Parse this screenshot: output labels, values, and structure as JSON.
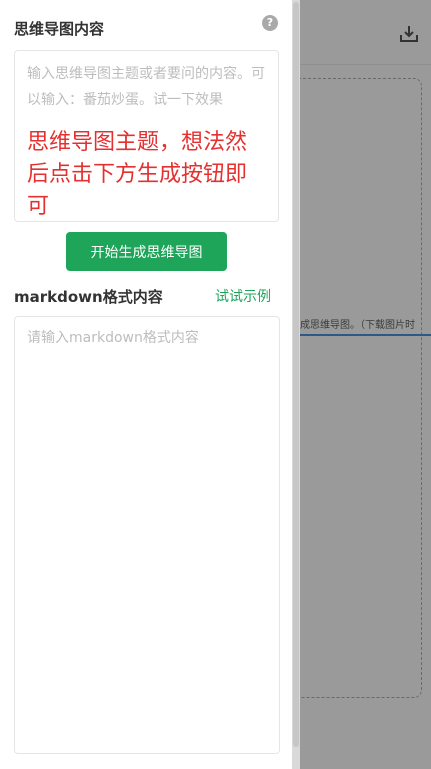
{
  "panel": {
    "title": "思维导图内容",
    "help_icon": "question-mark-icon",
    "topic_input": {
      "placeholder": "输入思维导图主题或者要问的内容。可以输入：番茄炒蛋。试一下效果",
      "annotation": "思维导图主题，想法然后点击下方生成按钮即可"
    },
    "generate_button": "开始生成思维导图",
    "markdown": {
      "title": "markdown格式内容",
      "try_example": "试试示例",
      "placeholder": "请输入markdown格式内容"
    }
  },
  "canvas": {
    "download_icon": "download-icon",
    "hint_text": "成思维导图。（下载图片时"
  },
  "colors": {
    "accent_green": "#1ea55a",
    "annotation_red": "#e53030",
    "overlay_gray": "#9a9a9a"
  }
}
